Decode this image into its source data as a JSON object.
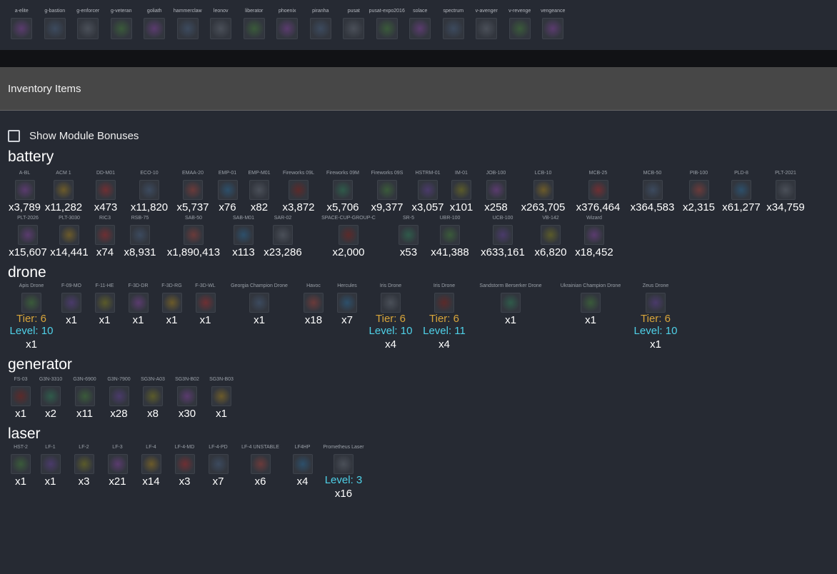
{
  "ships": [
    "a-elite",
    "g-bastion",
    "g-enforcer",
    "g-veteran",
    "goliath",
    "hammerclaw",
    "leonov",
    "liberator",
    "phoenix",
    "piranha",
    "pusat",
    "pusat-expo2016",
    "solace",
    "spectrum",
    "v-avenger",
    "v-revenge",
    "vengeance"
  ],
  "header": {
    "title": "Inventory Items"
  },
  "checkbox": {
    "label": "Show Module Bonuses"
  },
  "sections": {
    "battery": {
      "title": "battery",
      "row1": [
        {
          "n": "A-BL",
          "c": "x3,789"
        },
        {
          "n": "ACM 1",
          "c": "x11,282"
        },
        {
          "n": "DD-M01",
          "c": "x473"
        },
        {
          "n": "ECO-10",
          "c": "x11,820"
        },
        {
          "n": "EMAA-20",
          "c": "x5,737"
        },
        {
          "n": "EMP-01",
          "c": "x76"
        },
        {
          "n": "EMP-M01",
          "c": "x82"
        },
        {
          "n": "Fireworks 09L",
          "c": "x3,872"
        },
        {
          "n": "Fireworks 09M",
          "c": "x5,706"
        },
        {
          "n": "Fireworks 09S",
          "c": "x9,377"
        },
        {
          "n": "HSTRM-01",
          "c": "x3,057"
        },
        {
          "n": "IM-01",
          "c": "x101"
        },
        {
          "n": "JOB-100",
          "c": "x258"
        },
        {
          "n": "LCB-10",
          "c": "x263,705"
        },
        {
          "n": "MCB-25",
          "c": "x376,464"
        },
        {
          "n": "MCB-50",
          "c": "x364,583"
        },
        {
          "n": "PIB-100",
          "c": "x2,315"
        },
        {
          "n": "PLD-8",
          "c": "x61,277"
        },
        {
          "n": "PLT-2021",
          "c": "x34,759"
        }
      ],
      "row2": [
        {
          "n": "PLT-2026",
          "c": "x15,607"
        },
        {
          "n": "PLT-3030",
          "c": "x14,441"
        },
        {
          "n": "RIC3",
          "c": "x74"
        },
        {
          "n": "RSB-75",
          "c": "x8,931"
        },
        {
          "n": "SAB-50",
          "c": "x1,890,413"
        },
        {
          "n": "SAB-M01",
          "c": "x113"
        },
        {
          "n": "SAR-02",
          "c": "x23,286"
        },
        {
          "n": "SPACE-CUP-GROUP-C",
          "c": "x2,000"
        },
        {
          "n": "SR-5",
          "c": "x53"
        },
        {
          "n": "UBR-100",
          "c": "x41,388"
        },
        {
          "n": "UCB-100",
          "c": "x633,161"
        },
        {
          "n": "VB-142",
          "c": "x6,820"
        },
        {
          "n": "Wizard",
          "c": "x18,452"
        }
      ]
    },
    "drone": {
      "title": "drone",
      "items": [
        {
          "n": "Apis Drone",
          "tier": "Tier: 6",
          "level": "Level: 10",
          "c": "x1"
        },
        {
          "n": "F-09-MO",
          "c": "x1"
        },
        {
          "n": "F-11-HE",
          "c": "x1"
        },
        {
          "n": "F-3D-DR",
          "c": "x1"
        },
        {
          "n": "F-3D-RG",
          "c": "x1"
        },
        {
          "n": "F-3D-WL",
          "c": "x1"
        },
        {
          "n": "Georgia Champion Drone",
          "c": "x1"
        },
        {
          "n": "Havoc",
          "c": "x18"
        },
        {
          "n": "Hercules",
          "c": "x7"
        },
        {
          "n": "Iris Drone",
          "tier": "Tier: 6",
          "level": "Level: 10",
          "c": "x4"
        },
        {
          "n": "Iris Drone",
          "tier": "Tier: 6",
          "level": "Level: 11",
          "c": "x4"
        },
        {
          "n": "Sandstorm Berserker Drone",
          "c": "x1"
        },
        {
          "n": "Ukrainian Champion Drone",
          "c": "x1"
        },
        {
          "n": "Zeus Drone",
          "tier": "Tier: 6",
          "level": "Level: 10",
          "c": "x1"
        }
      ]
    },
    "generator": {
      "title": "generator",
      "items": [
        {
          "n": "FS-03",
          "c": "x1"
        },
        {
          "n": "G3N-3310",
          "c": "x2"
        },
        {
          "n": "G3N-6900",
          "c": "x11"
        },
        {
          "n": "G3N-7900",
          "c": "x28"
        },
        {
          "n": "SG3N-A03",
          "c": "x8"
        },
        {
          "n": "SG3N-B02",
          "c": "x30"
        },
        {
          "n": "SG3N-B03",
          "c": "x1"
        }
      ]
    },
    "laser": {
      "title": "laser",
      "items": [
        {
          "n": "HST-2",
          "c": "x1"
        },
        {
          "n": "LF-1",
          "c": "x1"
        },
        {
          "n": "LF-2",
          "c": "x3"
        },
        {
          "n": "LF-3",
          "c": "x21"
        },
        {
          "n": "LF-4",
          "c": "x14"
        },
        {
          "n": "LF-4-MD",
          "c": "x3"
        },
        {
          "n": "LF-4-PD",
          "c": "x7"
        },
        {
          "n": "LF-4 UNSTABLE",
          "c": "x6"
        },
        {
          "n": "LF4HP",
          "c": "x4"
        },
        {
          "n": "Prometheus Laser",
          "level": "Level: 3",
          "c": "x16"
        }
      ]
    }
  },
  "colors": {
    "background": "#262a33",
    "header_band": "#474747",
    "tier": "#d8a53a",
    "level": "#4fd1e8"
  }
}
